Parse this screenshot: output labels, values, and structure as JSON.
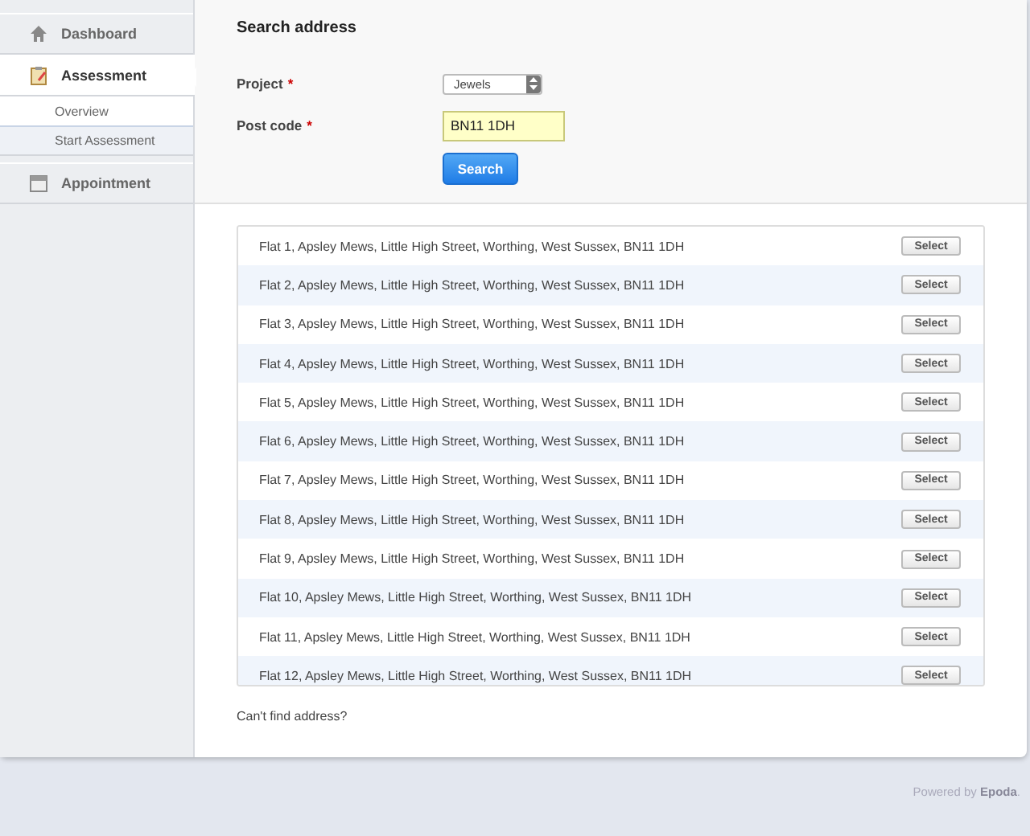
{
  "sidebar": {
    "items": [
      {
        "label": "Dashboard",
        "kind": "home",
        "selected": false
      },
      {
        "label": "Assessment",
        "kind": "clipboard",
        "selected": true,
        "children": [
          {
            "label": "Overview",
            "selected": false
          },
          {
            "label": "Start Assessment",
            "selected": true
          }
        ]
      },
      {
        "label": "Appointment",
        "kind": "calendar",
        "selected": false
      }
    ]
  },
  "form": {
    "title": "Search address",
    "fields": [
      {
        "kind": "select",
        "label": "Project",
        "required_mark": "*",
        "value": "Jewels"
      },
      {
        "kind": "text",
        "label": "Post code",
        "required_mark": "*",
        "value": "BN11 1DH"
      }
    ],
    "search_button": "Search"
  },
  "results": [
    {
      "address": "Flat 1, Apsley Mews, Little High Street, Worthing, West Sussex, BN11 1DH",
      "button": "Select"
    },
    {
      "address": "Flat 2, Apsley Mews, Little High Street, Worthing, West Sussex, BN11 1DH",
      "button": "Select"
    },
    {
      "address": "Flat 3, Apsley Mews, Little High Street, Worthing, West Sussex, BN11 1DH",
      "button": "Select"
    },
    {
      "address": "Flat 4, Apsley Mews, Little High Street, Worthing, West Sussex, BN11 1DH",
      "button": "Select"
    },
    {
      "address": "Flat 5, Apsley Mews, Little High Street, Worthing, West Sussex, BN11 1DH",
      "button": "Select"
    },
    {
      "address": "Flat 6, Apsley Mews, Little High Street, Worthing, West Sussex, BN11 1DH",
      "button": "Select"
    },
    {
      "address": "Flat 7, Apsley Mews, Little High Street, Worthing, West Sussex, BN11 1DH",
      "button": "Select"
    },
    {
      "address": "Flat 8, Apsley Mews, Little High Street, Worthing, West Sussex, BN11 1DH",
      "button": "Select"
    },
    {
      "address": "Flat 9, Apsley Mews, Little High Street, Worthing, West Sussex, BN11 1DH",
      "button": "Select"
    },
    {
      "address": "Flat 10, Apsley Mews, Little High Street, Worthing, West Sussex, BN11 1DH",
      "button": "Select"
    },
    {
      "address": "Flat 11, Apsley Mews, Little High Street, Worthing, West Sussex, BN11 1DH",
      "button": "Select"
    },
    {
      "address": "Flat 12, Apsley Mews, Little High Street, Worthing, West Sussex, BN11 1DH",
      "button": "Select"
    }
  ],
  "not_found_link": "Can't find address?",
  "footer": "Powered by **Epoda**."
}
